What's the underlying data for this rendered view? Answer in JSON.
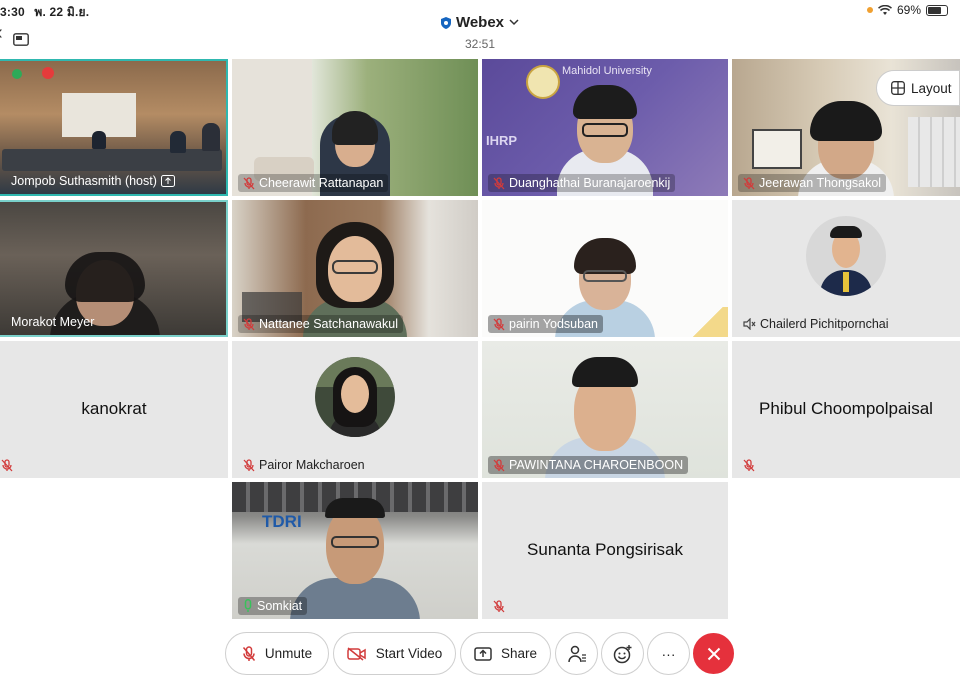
{
  "status_bar": {
    "time": "3:30",
    "date": "พ. 22 มิ.ย.",
    "battery": "69%"
  },
  "header": {
    "app_title": "Webex",
    "elapsed": "32:51"
  },
  "layout_button": {
    "label": "Layout"
  },
  "participants": [
    {
      "name": "Jompob Suthasmith (host)"
    },
    {
      "name": "Cheerawit Rattanapan"
    },
    {
      "name": "Duanghathai Buranajaroenkij"
    },
    {
      "name": "Jeerawan Thongsakol"
    },
    {
      "name": "Morakot Meyer"
    },
    {
      "name": "Nattanee Satchanawakul"
    },
    {
      "name": "pairin Yodsuban"
    },
    {
      "name": "Chailerd Pichitpornchai"
    },
    {
      "name": "kanokrat"
    },
    {
      "name": "Pairor Makcharoen"
    },
    {
      "name": "PAWINTANA CHAROENBOON"
    },
    {
      "name": "Phibul Choompolpaisal"
    },
    {
      "name": "Somkiat"
    },
    {
      "name": "Sunanta Pongsirisak"
    }
  ],
  "tile_text": {
    "mahidol": "Mahidol University",
    "ihrp": "IHRP",
    "tdri": "TDRI"
  },
  "controls": {
    "unmute": "Unmute",
    "start_video": "Start Video",
    "share": "Share",
    "more": "···"
  },
  "colors": {
    "accent": "#2fb8b0",
    "leave": "#e5313c",
    "muted": "#d23b3b"
  }
}
